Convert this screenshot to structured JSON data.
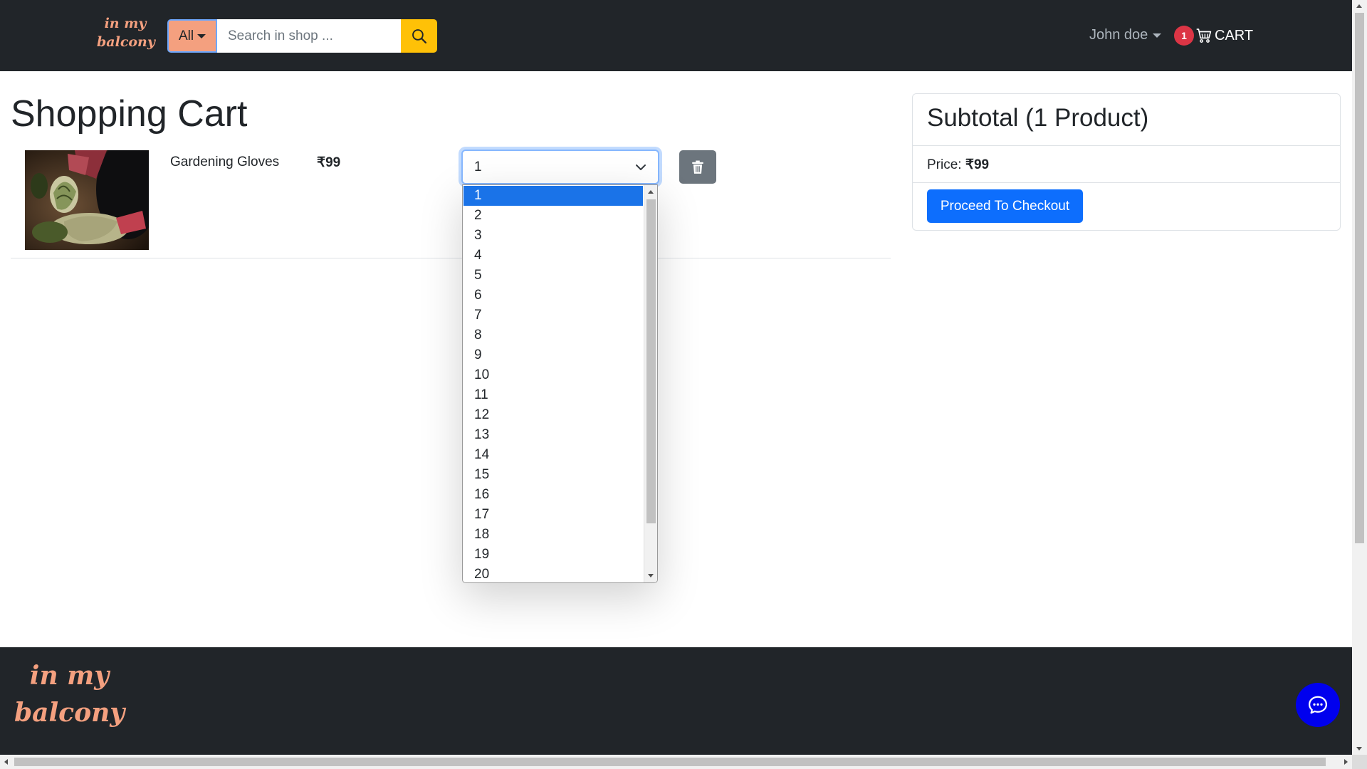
{
  "header": {
    "brand": "in my balcony",
    "category_label": "All",
    "search_placeholder": "Search in shop ...",
    "user_name": "John doe",
    "cart_count": "1",
    "cart_label": "CART"
  },
  "main": {
    "title": "Shopping Cart",
    "items": [
      {
        "name": "Gardening Gloves",
        "price": "₹99",
        "quantity": "1",
        "image_icon": "gardening-gloves-photo"
      }
    ]
  },
  "quantity_options": [
    "1",
    "2",
    "3",
    "4",
    "5",
    "6",
    "7",
    "8",
    "9",
    "10",
    "11",
    "12",
    "13",
    "14",
    "15",
    "16",
    "17",
    "18",
    "19",
    "20"
  ],
  "summary": {
    "title": "Subtotal (1 Product)",
    "price_label": "Price:",
    "price_value": "₹99",
    "checkout_label": "Proceed To Checkout"
  },
  "footer": {
    "brand": "in my balcony"
  },
  "colors": {
    "navbar": "#212529",
    "brand": "#f4a07f",
    "search_button": "#ffc107",
    "primary": "#0d6efd",
    "badge": "#dc3545",
    "chat": "#0000ee",
    "selected_option": "#1a73e8"
  }
}
